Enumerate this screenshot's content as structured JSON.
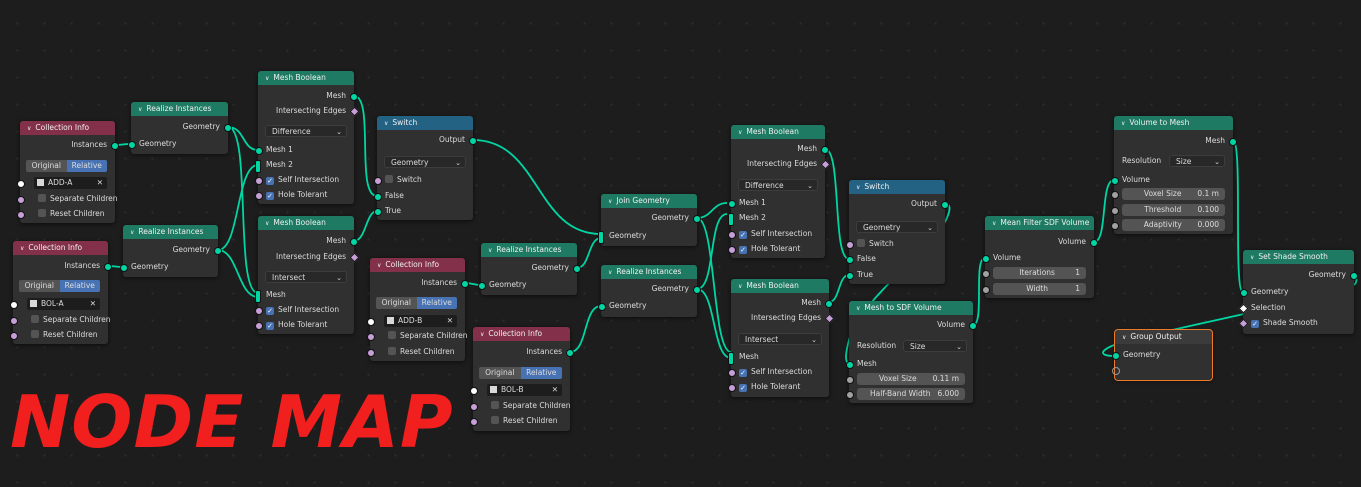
{
  "title_overlay": "NODE MAP",
  "colors": {
    "geometry_socket": "#00d6a3",
    "link": "#00d6a3",
    "header_input": "#83314a",
    "header_geometry": "#1e7a62",
    "header_converter": "#246283",
    "selection": "#ed7a28",
    "title": "#f21f1f"
  },
  "collinfo1": {
    "title": "Collection Info",
    "out": "Instances",
    "seg_a": "Original",
    "seg_b": "Relative",
    "object": "ADD-A",
    "sep": "Separate Children",
    "reset": "Reset Children"
  },
  "collinfo2": {
    "title": "Collection Info",
    "out": "Instances",
    "seg_a": "Original",
    "seg_b": "Relative",
    "object": "BOL-A",
    "sep": "Separate Children",
    "reset": "Reset Children"
  },
  "collinfo3": {
    "title": "Collection Info",
    "out": "Instances",
    "seg_a": "Original",
    "seg_b": "Relative",
    "object": "ADD-B",
    "sep": "Separate Children",
    "reset": "Reset Children"
  },
  "collinfo4": {
    "title": "Collection Info",
    "out": "Instances",
    "seg_a": "Original",
    "seg_b": "Relative",
    "object": "BOL-B",
    "sep": "Separate Children",
    "reset": "Reset Children"
  },
  "realize1": {
    "title": "Realize Instances",
    "out": "Geometry",
    "in": "Geometry"
  },
  "realize2": {
    "title": "Realize Instances",
    "out": "Geometry",
    "in": "Geometry"
  },
  "realize3": {
    "title": "Realize Instances",
    "out": "Geometry",
    "in": "Geometry"
  },
  "realize4": {
    "title": "Realize Instances",
    "out": "Geometry",
    "in": "Geometry"
  },
  "bool1": {
    "title": "Mesh Boolean",
    "out_mesh": "Mesh",
    "out_edges": "Intersecting Edges",
    "mode": "Difference",
    "mesh1": "Mesh 1",
    "mesh2": "Mesh 2",
    "self": "Self Intersection",
    "hole": "Hole Tolerant"
  },
  "bool2": {
    "title": "Mesh Boolean",
    "out_mesh": "Mesh",
    "out_edges": "Intersecting Edges",
    "mode": "Intersect",
    "mesh": "Mesh",
    "self": "Self Intersection",
    "hole": "Hole Tolerant"
  },
  "bool3": {
    "title": "Mesh Boolean",
    "out_mesh": "Mesh",
    "out_edges": "Intersecting Edges",
    "mode": "Difference",
    "mesh1": "Mesh 1",
    "mesh2": "Mesh 2",
    "self": "Self Intersection",
    "hole": "Hole Tolerant"
  },
  "bool4": {
    "title": "Mesh Boolean",
    "out_mesh": "Mesh",
    "out_edges": "Intersecting Edges",
    "mode": "Intersect",
    "mesh": "Mesh",
    "self": "Self Intersection",
    "hole": "Hole Tolerant"
  },
  "switch1": {
    "title": "Switch",
    "out": "Output",
    "type": "Geometry",
    "sw": "Switch",
    "f": "False",
    "t": "True"
  },
  "switch2": {
    "title": "Switch",
    "out": "Output",
    "type": "Geometry",
    "sw": "Switch",
    "f": "False",
    "t": "True"
  },
  "join": {
    "title": "Join Geometry",
    "out": "Geometry",
    "in": "Geometry"
  },
  "mesh2sdf": {
    "title": "Mesh to SDF Volume",
    "out": "Volume",
    "res_label": "Resolution",
    "res_val": "Size",
    "mesh": "Mesh",
    "voxel_label": "Voxel Size",
    "voxel_val": "0.11 m",
    "hb_label": "Half-Band Width",
    "hb_val": "6.000"
  },
  "meanfilter": {
    "title": "Mean Filter SDF Volume",
    "out": "Volume",
    "vol": "Volume",
    "iter_label": "Iterations",
    "iter_val": "1",
    "width_label": "Width",
    "width_val": "1"
  },
  "vol2mesh": {
    "title": "Volume to Mesh",
    "out": "Mesh",
    "res_label": "Resolution",
    "res_val": "Size",
    "vol": "Volume",
    "voxel_label": "Voxel Size",
    "voxel_val": "0.1 m",
    "thr_label": "Threshold",
    "thr_val": "0.100",
    "ad_label": "Adaptivity",
    "ad_val": "0.000"
  },
  "shade": {
    "title": "Set Shade Smooth",
    "out": "Geometry",
    "geo": "Geometry",
    "sel": "Selection",
    "smooth": "Shade Smooth"
  },
  "groupout": {
    "title": "Group Output",
    "geo": "Geometry"
  }
}
